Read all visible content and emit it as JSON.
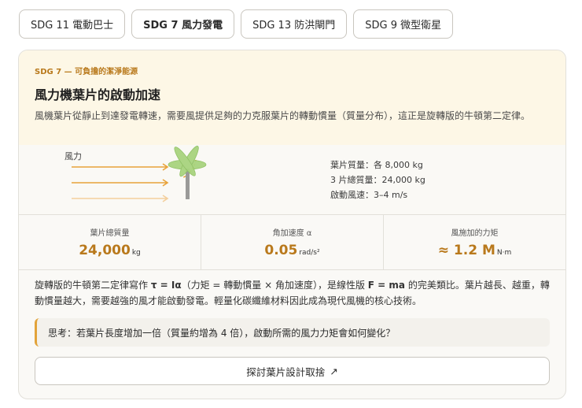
{
  "tabs": [
    {
      "label": "SDG 11 電動巴士"
    },
    {
      "label": "SDG 7 風力發電"
    },
    {
      "label": "SDG 13 防洪閘門"
    },
    {
      "label": "SDG 9 微型衛星"
    }
  ],
  "card": {
    "eyebrow": "SDG 7 — 可負擔的潔淨能源",
    "title": "風力機葉片的啟動加速",
    "description": "風機葉片從靜止到達發電轉速，需要風提供足夠的力克服葉片的轉動慣量（質量分布），這正是旋轉版的牛頓第二定律。",
    "illustration": {
      "wind_label": "風力",
      "facts": [
        "葉片質量：各 8,000 kg",
        "3 片總質量：24,000 kg",
        "啟動風速：3–4 m/s"
      ]
    },
    "stats": [
      {
        "label": "葉片總質量",
        "value": "24,000",
        "unit": "kg"
      },
      {
        "label": "角加速度 α",
        "value": "0.05",
        "unit": "rad/s²"
      },
      {
        "label": "風施加的力矩",
        "value": "≈ 1.2 M",
        "unit": "N·m"
      }
    ],
    "body": {
      "pre": "旋轉版的牛頓第二定律寫作 ",
      "formula": "τ = Iα",
      "mid": "（力矩 = 轉動慣量 × 角加速度），是線性版 ",
      "formula2": "F = ma",
      "post": " 的完美類比。葉片越長、越重，轉動慣量越大，需要越強的風才能啟動發電。輕量化碳纖維材料因此成為現代風機的核心技術。"
    },
    "callout": "思考：若葉片長度增加一倍（質量約增為 4 倍），啟動所需的風力力矩會如何變化？",
    "button": {
      "label": "探討葉片設計取捨",
      "icon": "↗"
    }
  },
  "colors": {
    "accent": "#b9791c",
    "arrow": "#e8a33a",
    "blade": "#a8d47e"
  }
}
